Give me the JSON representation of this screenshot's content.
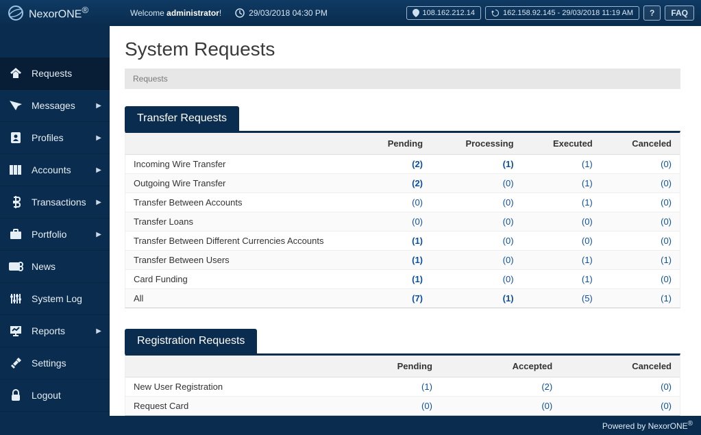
{
  "brand": {
    "name": "NexorONE",
    "reg": "®"
  },
  "topbar": {
    "welcome_prefix": "Welcome ",
    "welcome_user": "administrator",
    "welcome_suffix": "!",
    "datetime": "29/03/2018 04:30 PM",
    "ip1": "108.162.212.14",
    "ip2": "162.158.92.145 - 29/03/2018 11:19 AM",
    "help": "?",
    "faq": "FAQ"
  },
  "sidebar": {
    "items": [
      {
        "label": "Requests",
        "active": true,
        "icon": "requests",
        "arrow": false
      },
      {
        "label": "Messages",
        "active": false,
        "icon": "messages",
        "arrow": true
      },
      {
        "label": "Profiles",
        "active": false,
        "icon": "profiles",
        "arrow": true
      },
      {
        "label": "Accounts",
        "active": false,
        "icon": "accounts",
        "arrow": true
      },
      {
        "label": "Transactions",
        "active": false,
        "icon": "transactions",
        "arrow": true
      },
      {
        "label": "Portfolio",
        "active": false,
        "icon": "portfolio",
        "arrow": true
      },
      {
        "label": "News",
        "active": false,
        "icon": "news",
        "arrow": false
      },
      {
        "label": "System Log",
        "active": false,
        "icon": "systemlog",
        "arrow": false
      },
      {
        "label": "Reports",
        "active": false,
        "icon": "reports",
        "arrow": true
      },
      {
        "label": "Settings",
        "active": false,
        "icon": "settings",
        "arrow": false
      },
      {
        "label": "Logout",
        "active": false,
        "icon": "logout",
        "arrow": false
      }
    ]
  },
  "page": {
    "title": "System Requests",
    "breadcrumb": "Requests"
  },
  "panel1": {
    "title": "Transfer Requests",
    "headers": [
      "",
      "Pending",
      "Processing",
      "Executed",
      "Canceled"
    ],
    "rows": [
      {
        "name": "Incoming Wire Transfer",
        "v": [
          "(2)",
          "(1)",
          "(1)",
          "(0)"
        ],
        "bold": [
          true,
          true,
          false,
          false
        ]
      },
      {
        "name": "Outgoing Wire Transfer",
        "v": [
          "(2)",
          "(0)",
          "(1)",
          "(0)"
        ],
        "bold": [
          true,
          false,
          false,
          false
        ]
      },
      {
        "name": "Transfer Between Accounts",
        "v": [
          "(0)",
          "(0)",
          "(1)",
          "(0)"
        ],
        "bold": [
          false,
          false,
          false,
          false
        ]
      },
      {
        "name": "Transfer Loans",
        "v": [
          "(0)",
          "(0)",
          "(0)",
          "(0)"
        ],
        "bold": [
          false,
          false,
          false,
          false
        ]
      },
      {
        "name": "Transfer Between Different Currencies Accounts",
        "v": [
          "(1)",
          "(0)",
          "(0)",
          "(0)"
        ],
        "bold": [
          true,
          false,
          false,
          false
        ]
      },
      {
        "name": "Transfer Between Users",
        "v": [
          "(1)",
          "(0)",
          "(1)",
          "(1)"
        ],
        "bold": [
          true,
          false,
          false,
          false
        ]
      },
      {
        "name": "Card Funding",
        "v": [
          "(1)",
          "(0)",
          "(1)",
          "(0)"
        ],
        "bold": [
          true,
          false,
          false,
          false
        ]
      },
      {
        "name": "All",
        "v": [
          "(7)",
          "(1)",
          "(5)",
          "(1)"
        ],
        "bold": [
          true,
          true,
          false,
          false
        ]
      }
    ]
  },
  "panel2": {
    "title": "Registration Requests",
    "headers": [
      "",
      "Pending",
      "Accepted",
      "Canceled"
    ],
    "rows": [
      {
        "name": "New User Registration",
        "v": [
          "(1)",
          "(2)",
          "(0)"
        ]
      },
      {
        "name": "Request Card",
        "v": [
          "(0)",
          "(0)",
          "(0)"
        ]
      }
    ]
  },
  "footer": {
    "text": "Powered by NexorONE",
    "reg": "®"
  }
}
